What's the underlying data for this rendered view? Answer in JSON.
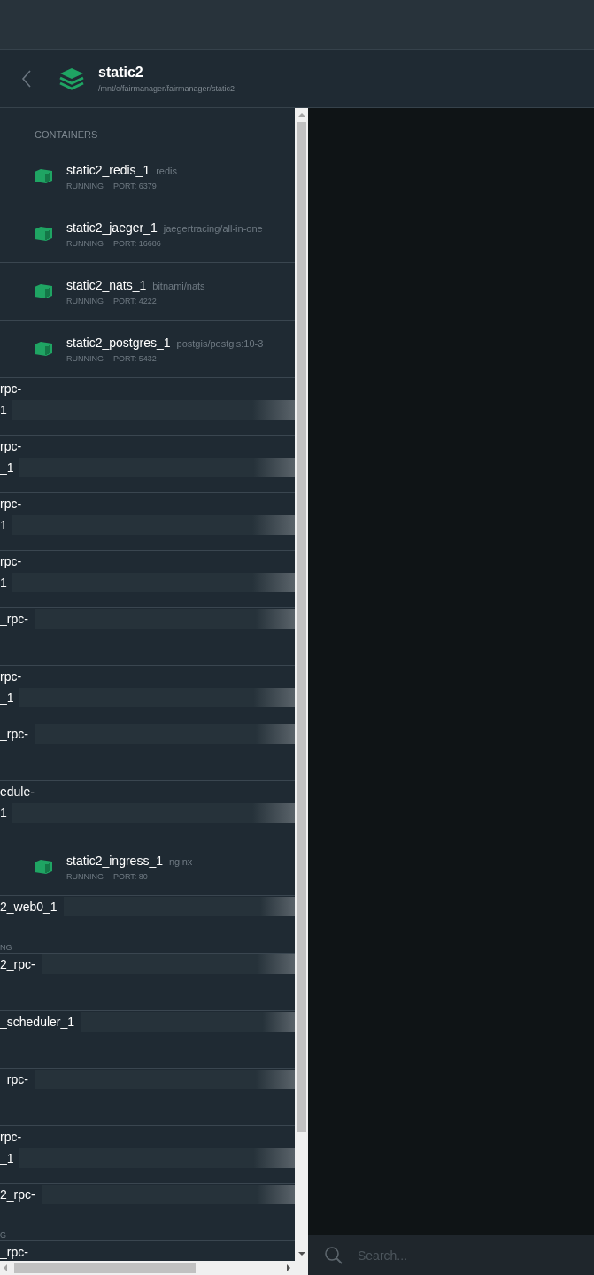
{
  "project": {
    "name": "static2",
    "path": "/mnt/c/fairmanager/fairmanager/static2"
  },
  "section_title": "CONTAINERS",
  "containers": [
    {
      "kind": "full",
      "name": "static2_redis_1",
      "image": "redis",
      "status": "RUNNING",
      "port": "PORT: 6379"
    },
    {
      "kind": "full",
      "name": "static2_jaeger_1",
      "image": "jaegertracing/all-in-one",
      "status": "RUNNING",
      "port": "PORT: 16686"
    },
    {
      "kind": "full",
      "name": "static2_nats_1",
      "image": "bitnami/nats",
      "status": "RUNNING",
      "port": "PORT: 4222"
    },
    {
      "kind": "full",
      "name": "static2_postgres_1",
      "image": "postgis/postgis:10-3",
      "status": "RUNNING",
      "port": "PORT: 5432"
    },
    {
      "kind": "scrolled",
      "line_1": "rpc-",
      "line_2": "1",
      "redacted": true
    },
    {
      "kind": "scrolled",
      "line_1": "rpc-",
      "line_2": "_1",
      "redacted": true
    },
    {
      "kind": "scrolled",
      "line_1": "rpc-",
      "line_2": "1",
      "redacted": true
    },
    {
      "kind": "scrolled",
      "line_1": "rpc-",
      "line_2": "1",
      "redacted": true
    },
    {
      "kind": "scrolled",
      "line_1": "_rpc-",
      "redacted": true
    },
    {
      "kind": "scrolled",
      "line_1": "rpc-",
      "line_2": "_1",
      "redacted": true
    },
    {
      "kind": "scrolled",
      "line_1": "_rpc-",
      "redacted": true
    },
    {
      "kind": "scrolled",
      "line_1": "edule-",
      "line_2": "1",
      "redacted": true
    },
    {
      "kind": "full",
      "name": "static2_ingress_1",
      "image": "nginx",
      "status": "RUNNING",
      "port": "PORT: 80"
    },
    {
      "kind": "scrolled",
      "line_1": "2_web0_1",
      "line_3": "NG",
      "redacted": true
    },
    {
      "kind": "scrolled",
      "line_1": "2_rpc-",
      "redacted": true
    },
    {
      "kind": "scrolled",
      "line_1": "_scheduler_1",
      "redacted": true
    },
    {
      "kind": "scrolled",
      "line_1": "_rpc-",
      "redacted": true
    },
    {
      "kind": "scrolled",
      "line_1": "rpc-",
      "line_2": "_1",
      "redacted": true
    },
    {
      "kind": "scrolled",
      "line_1": "2_rpc-",
      "line_3": "G",
      "redacted": true
    },
    {
      "kind": "scrolled",
      "line_1": "_rpc-",
      "redacted": false
    }
  ],
  "search": {
    "placeholder": "Search..."
  }
}
